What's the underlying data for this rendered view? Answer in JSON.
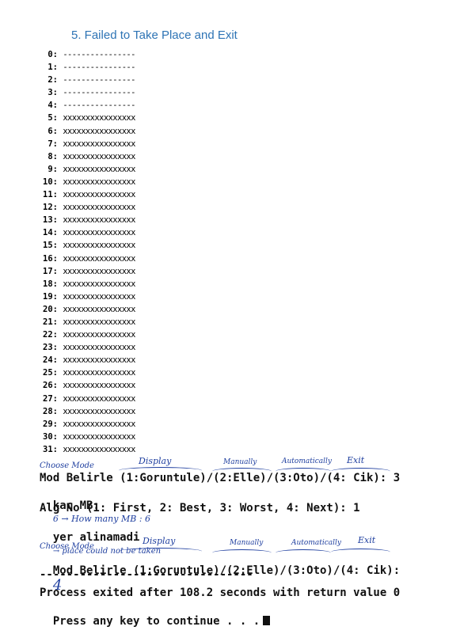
{
  "title": "5. Failed to Take Place and Exit",
  "memory": [
    {
      "idx": "0:",
      "cells": "----------------"
    },
    {
      "idx": "1:",
      "cells": "----------------"
    },
    {
      "idx": "2:",
      "cells": "----------------"
    },
    {
      "idx": "3:",
      "cells": "----------------"
    },
    {
      "idx": "4:",
      "cells": "----------------"
    },
    {
      "idx": "5:",
      "cells": "xxxxxxxxxxxxxxxx"
    },
    {
      "idx": "6:",
      "cells": "xxxxxxxxxxxxxxxx"
    },
    {
      "idx": "7:",
      "cells": "xxxxxxxxxxxxxxxx"
    },
    {
      "idx": "8:",
      "cells": "xxxxxxxxxxxxxxxx"
    },
    {
      "idx": "9:",
      "cells": "xxxxxxxxxxxxxxxx"
    },
    {
      "idx": "10:",
      "cells": "xxxxxxxxxxxxxxxx"
    },
    {
      "idx": "11:",
      "cells": "xxxxxxxxxxxxxxxx"
    },
    {
      "idx": "12:",
      "cells": "xxxxxxxxxxxxxxxx"
    },
    {
      "idx": "13:",
      "cells": "xxxxxxxxxxxxxxxx"
    },
    {
      "idx": "14:",
      "cells": "xxxxxxxxxxxxxxxx"
    },
    {
      "idx": "15:",
      "cells": "xxxxxxxxxxxxxxxx"
    },
    {
      "idx": "16:",
      "cells": "xxxxxxxxxxxxxxxx"
    },
    {
      "idx": "17:",
      "cells": "xxxxxxxxxxxxxxxx"
    },
    {
      "idx": "18:",
      "cells": "xxxxxxxxxxxxxxxx"
    },
    {
      "idx": "19:",
      "cells": "xxxxxxxxxxxxxxxx"
    },
    {
      "idx": "20:",
      "cells": "xxxxxxxxxxxxxxxx"
    },
    {
      "idx": "21:",
      "cells": "xxxxxxxxxxxxxxxx"
    },
    {
      "idx": "22:",
      "cells": "xxxxxxxxxxxxxxxx"
    },
    {
      "idx": "23:",
      "cells": "xxxxxxxxxxxxxxxx"
    },
    {
      "idx": "24:",
      "cells": "xxxxxxxxxxxxxxxx"
    },
    {
      "idx": "25:",
      "cells": "xxxxxxxxxxxxxxxx"
    },
    {
      "idx": "26:",
      "cells": "xxxxxxxxxxxxxxxx"
    },
    {
      "idx": "27:",
      "cells": "xxxxxxxxxxxxxxxx"
    },
    {
      "idx": "28:",
      "cells": "xxxxxxxxxxxxxxxx"
    },
    {
      "idx": "29:",
      "cells": "xxxxxxxxxxxxxxxx"
    },
    {
      "idx": "30:",
      "cells": "xxxxxxxxxxxxxxxx"
    },
    {
      "idx": "31:",
      "cells": "xxxxxxxxxxxxxxxx"
    }
  ],
  "annotations1": {
    "choose": "Choose Mode",
    "display": "Display",
    "manually": "Manually",
    "auto": "Automatically",
    "exit": "Exit"
  },
  "console": {
    "mode_prompt_1": "Mod Belirle (1:Goruntule)/(2:Elle)/(3:Oto)/(4: Cik): 3",
    "mb_prompt": "kac MB:",
    "mb_note": "6 → How many MB : 6",
    "alg_prompt": "Alg No (1: First, 2: Best, 3: Worst, 4: Next): 1",
    "fail_msg": "yer alinamadi",
    "fail_note": "→ place could not be taken",
    "mode_prompt_2": "Mod Belirle (1:Goruntule)/(2:Elle)/(3:Oto)/(4: Cik):",
    "mode_input_2": "4",
    "separator": "--------------------------------",
    "exit_msg": "Process exited after 108.2 seconds with return value 0",
    "continue_msg": "Press any key to continue . . ."
  },
  "annotations2": {
    "choose": "Choose Mode",
    "display": "Display",
    "manually": "Manually",
    "auto": "Automatically",
    "exit": "Exit"
  }
}
